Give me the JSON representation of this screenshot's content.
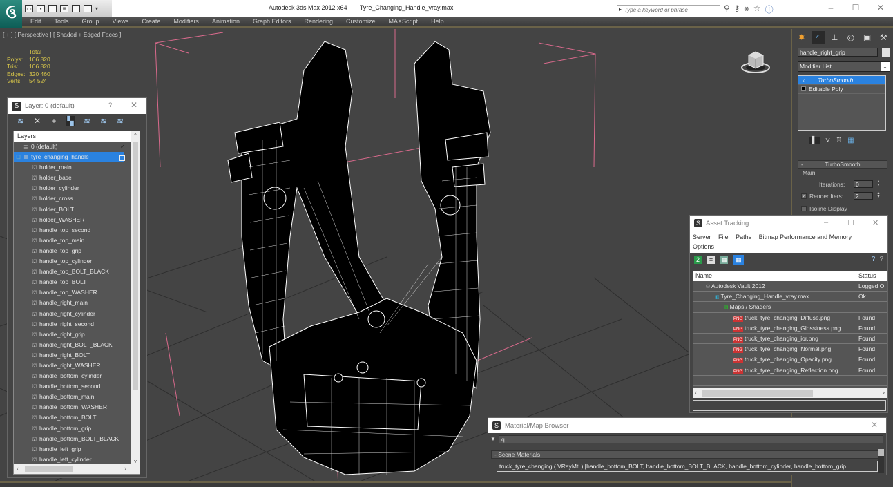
{
  "app": {
    "title": "Autodesk 3ds Max  2012 x64",
    "file": "Tyre_Changing_Handle_vray.max",
    "logo": "3ds-max-logo",
    "search_placeholder": "Type a keyword or phrase",
    "title_icons": [
      "binoculars-icon",
      "key-icon",
      "communication-icon",
      "star-icon",
      "help-icon"
    ],
    "window_controls": {
      "minimize": "–",
      "maximize": "☐",
      "close": "✕"
    }
  },
  "qat": {
    "icons": [
      "open-icon",
      "save-icon",
      "undo-icon",
      "redo-icon",
      "hold-icon",
      "fetch-icon",
      "dropdown-icon"
    ]
  },
  "menu": [
    "Edit",
    "Tools",
    "Group",
    "Views",
    "Create",
    "Modifiers",
    "Animation",
    "Graph Editors",
    "Rendering",
    "Customize",
    "MAXScript",
    "Help"
  ],
  "viewport": {
    "label": "[ + ] [ Perspective ] [ Shaded + Edged Faces ]",
    "stats": {
      "header": "Total",
      "rows": [
        {
          "k": "Polys:",
          "v": "106 820"
        },
        {
          "k": "Tris:",
          "v": "106 820"
        },
        {
          "k": "Edges:",
          "v": "320 460"
        },
        {
          "k": "Verts:",
          "v": "54 524"
        }
      ]
    }
  },
  "layer_dialog": {
    "title": "Layer: 0 (default)",
    "help": "?",
    "close": "✕",
    "header": "Layers",
    "layers": [
      {
        "name": "0 (default)",
        "level": 0,
        "state": "check"
      },
      {
        "name": "tyre_changing_handle",
        "level": 0,
        "state": "box",
        "selected": true
      }
    ],
    "objects": [
      "holder_main",
      "holder_base",
      "holder_cylinder",
      "holder_cross",
      "holder_BOLT",
      "holder_WASHER",
      "handle_top_second",
      "handle_top_main",
      "handle_top_grip",
      "handle_top_cylinder",
      "handle_top_BOLT_BLACK",
      "handle_top_BOLT",
      "handle_top_WASHER",
      "handle_right_main",
      "handle_right_cylinder",
      "handle_right_second",
      "handle_right_grip",
      "handle_right_BOLT_BLACK",
      "handle_right_BOLT",
      "handle_right_WASHER",
      "handle_bottom_cylinder",
      "handle_bottom_second",
      "handle_bottom_main",
      "handle_bottom_WASHER",
      "handle_bottom_BOLT",
      "handle_bottom_grip",
      "handle_bottom_BOLT_BLACK",
      "handle_left_grip",
      "handle_left_cylinder"
    ]
  },
  "command_panel": {
    "object_name": "handle_right_grip",
    "modifier_list": "Modifier List",
    "stack": [
      {
        "name": "TurboSmooth",
        "selected": true
      },
      {
        "name": "Editable Poly",
        "selected": false
      }
    ],
    "rollout": {
      "title": "TurboSmooth",
      "group": "Main",
      "iterations_label": "Iterations:",
      "iterations": "0",
      "render_iters_label": "Render Iters:",
      "render_iters": "2",
      "render_iters_checked": true,
      "isoline_label": "Isoline Display",
      "isoline_checked": false
    }
  },
  "asset_tracking": {
    "title": "Asset Tracking",
    "menu": [
      "Server",
      "File",
      "Paths",
      "Bitmap Performance and Memory",
      "Options"
    ],
    "columns": [
      "Name",
      "Status"
    ],
    "rows": [
      {
        "name": "Autodesk Vault 2012",
        "status": "Logged O",
        "level": 1,
        "icon": "vault"
      },
      {
        "name": "Tyre_Changing_Handle_vray.max",
        "status": "Ok",
        "level": 2,
        "icon": "max"
      },
      {
        "name": "Maps / Shaders",
        "status": "",
        "level": 3,
        "icon": "maps"
      },
      {
        "name": "truck_tyre_changing_Diffuse.png",
        "status": "Found",
        "level": 4,
        "icon": "png"
      },
      {
        "name": "truck_tyre_changing_Glossiness.png",
        "status": "Found",
        "level": 4,
        "icon": "png"
      },
      {
        "name": "truck_tyre_changing_ior.png",
        "status": "Found",
        "level": 4,
        "icon": "png"
      },
      {
        "name": "truck_tyre_changing_Normal.png",
        "status": "Found",
        "level": 4,
        "icon": "png"
      },
      {
        "name": "truck_tyre_changing_Opacity.png",
        "status": "Found",
        "level": 4,
        "icon": "png"
      },
      {
        "name": "truck_tyre_changing_Reflection.png",
        "status": "Found",
        "level": 4,
        "icon": "png"
      }
    ]
  },
  "material_browser": {
    "title": "Material/Map Browser",
    "search_value": "q",
    "group": "- Scene Materials",
    "item": "truck_tyre_changing ( VRayMtl ) [handle_bottom_BOLT, handle_bottom_BOLT_BLACK, handle_bottom_cylinder, handle_bottom_grip..."
  },
  "colors": {
    "selection": "#2a82e0",
    "stats": "#d9c74a",
    "viewport_bg": "#444444",
    "gizmo": "#d86a8c"
  }
}
